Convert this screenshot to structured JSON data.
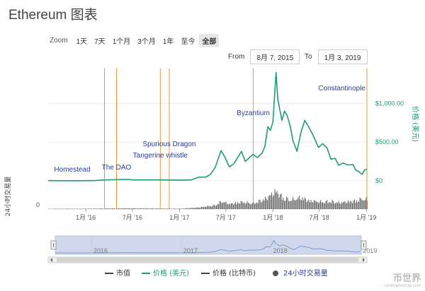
{
  "title": "Ethereum 图表",
  "zoom": {
    "label": "Zoom",
    "buttons": [
      "1天",
      "7天",
      "1个月",
      "3个月",
      "1年",
      "至今",
      "全部"
    ],
    "active": 6
  },
  "range": {
    "from_label": "From",
    "from_value": "8月 7, 2015",
    "to_label": "To",
    "to_value": "1月 3, 2019"
  },
  "colors": {
    "price": "#1f9a7a",
    "event": "#e8953a",
    "volume": "#555555",
    "marketcap": "#444444",
    "navigator_fill": "#cfd8ec"
  },
  "watermark": {
    "cn": "币世界",
    "en": "coinmarketcap.com"
  },
  "chart_data": {
    "type": "line",
    "x_range": [
      "2015-08-07",
      "2019-01-03"
    ],
    "x_ticks": [
      {
        "date": "2016-01-01",
        "label": "1月 '16"
      },
      {
        "date": "2016-07-01",
        "label": "7月 '16"
      },
      {
        "date": "2017-01-01",
        "label": "1月 '17"
      },
      {
        "date": "2017-07-01",
        "label": "7月 '17"
      },
      {
        "date": "2018-01-01",
        "label": "1月 '18"
      },
      {
        "date": "2018-07-01",
        "label": "7月 '18"
      },
      {
        "date": "2019-01-01",
        "label": "1月 '19"
      }
    ],
    "y_right": {
      "label": "价格 (美元)",
      "range": [
        0,
        1450
      ],
      "ticks": [
        {
          "value": 0,
          "label": "$0"
        },
        {
          "value": 500,
          "label": "$500.00"
        },
        {
          "value": 1000,
          "label": "$1,000.00"
        }
      ]
    },
    "y_left": {
      "label": "24小时交易量",
      "ticks": [
        {
          "value": 0,
          "label": "0"
        }
      ]
    },
    "series": [
      {
        "name": "价格 (美元)",
        "points": [
          [
            "2015-08-07",
            2.8
          ],
          [
            "2015-11-01",
            1.0
          ],
          [
            "2016-02-01",
            2.5
          ],
          [
            "2016-03-15",
            12
          ],
          [
            "2016-06-15",
            18
          ],
          [
            "2016-07-01",
            12
          ],
          [
            "2016-10-15",
            12
          ],
          [
            "2017-01-01",
            8
          ],
          [
            "2017-02-15",
            12
          ],
          [
            "2017-03-15",
            45
          ],
          [
            "2017-04-15",
            50
          ],
          [
            "2017-05-01",
            80
          ],
          [
            "2017-05-20",
            170
          ],
          [
            "2017-06-12",
            390
          ],
          [
            "2017-06-25",
            320
          ],
          [
            "2017-07-15",
            180
          ],
          [
            "2017-08-01",
            220
          ],
          [
            "2017-08-31",
            380
          ],
          [
            "2017-09-15",
            250
          ],
          [
            "2017-10-01",
            300
          ],
          [
            "2017-10-15",
            340
          ],
          [
            "2017-11-01",
            300
          ],
          [
            "2017-11-20",
            360
          ],
          [
            "2017-12-01",
            450
          ],
          [
            "2017-12-12",
            700
          ],
          [
            "2017-12-22",
            650
          ],
          [
            "2018-01-01",
            760
          ],
          [
            "2018-01-13",
            1400
          ],
          [
            "2018-01-20",
            1050
          ],
          [
            "2018-02-05",
            780
          ],
          [
            "2018-02-15",
            900
          ],
          [
            "2018-02-25",
            850
          ],
          [
            "2018-03-10",
            700
          ],
          [
            "2018-03-20",
            520
          ],
          [
            "2018-04-05",
            380
          ],
          [
            "2018-04-20",
            620
          ],
          [
            "2018-05-05",
            780
          ],
          [
            "2018-05-20",
            700
          ],
          [
            "2018-06-05",
            600
          ],
          [
            "2018-06-28",
            430
          ],
          [
            "2018-07-15",
            480
          ],
          [
            "2018-08-01",
            420
          ],
          [
            "2018-08-15",
            280
          ],
          [
            "2018-09-01",
            290
          ],
          [
            "2018-09-15",
            200
          ],
          [
            "2018-10-01",
            230
          ],
          [
            "2018-10-20",
            205
          ],
          [
            "2018-11-10",
            210
          ],
          [
            "2018-11-20",
            140
          ],
          [
            "2018-12-01",
            120
          ],
          [
            "2018-12-15",
            85
          ],
          [
            "2018-12-25",
            140
          ],
          [
            "2019-01-03",
            150
          ]
        ]
      },
      {
        "name": "24小时交易量",
        "points": [
          [
            "2015-08-07",
            0.2
          ],
          [
            "2016-01-01",
            0.3
          ],
          [
            "2016-06-15",
            0.6
          ],
          [
            "2017-01-01",
            0.3
          ],
          [
            "2017-03-15",
            1.2
          ],
          [
            "2017-05-20",
            3.0
          ],
          [
            "2017-06-12",
            6.0
          ],
          [
            "2017-07-15",
            4.0
          ],
          [
            "2017-08-31",
            5.5
          ],
          [
            "2017-10-15",
            4.5
          ],
          [
            "2017-12-01",
            8.0
          ],
          [
            "2017-12-22",
            11.0
          ],
          [
            "2018-01-13",
            14.0
          ],
          [
            "2018-02-05",
            9.0
          ],
          [
            "2018-03-10",
            7.0
          ],
          [
            "2018-04-20",
            9.0
          ],
          [
            "2018-05-20",
            6.5
          ],
          [
            "2018-07-15",
            5.5
          ],
          [
            "2018-08-15",
            6.0
          ],
          [
            "2018-09-15",
            5.0
          ],
          [
            "2018-11-20",
            6.5
          ],
          [
            "2018-12-15",
            8.0
          ],
          [
            "2019-01-03",
            7.0
          ]
        ]
      }
    ],
    "events": [
      {
        "label": "Homestead",
        "date": "2016-03-14"
      },
      {
        "label": "The DAO",
        "date": "2016-04-30"
      },
      {
        "label": "Tangerine whistle",
        "date": "2016-10-18"
      },
      {
        "label": "Spurious Dragon",
        "date": "2016-11-22"
      },
      {
        "label": "Byzantium",
        "date": "2017-10-16"
      },
      {
        "label": "Constantinople",
        "date": "2019-01-03"
      }
    ],
    "navigator": {
      "year_labels": [
        "2016",
        "2017",
        "2018",
        "2019"
      ]
    },
    "legend": {
      "position": "bottom",
      "items": [
        {
          "label": "市值",
          "symbol": "line",
          "color": "#444444"
        },
        {
          "label": "价格 (美元)",
          "symbol": "line",
          "color": "#1f9a7a"
        },
        {
          "label": "价格 (比特币)",
          "symbol": "line",
          "color": "#444444"
        },
        {
          "label": "24小时交易量",
          "symbol": "circle",
          "color": "#555555"
        }
      ]
    }
  }
}
